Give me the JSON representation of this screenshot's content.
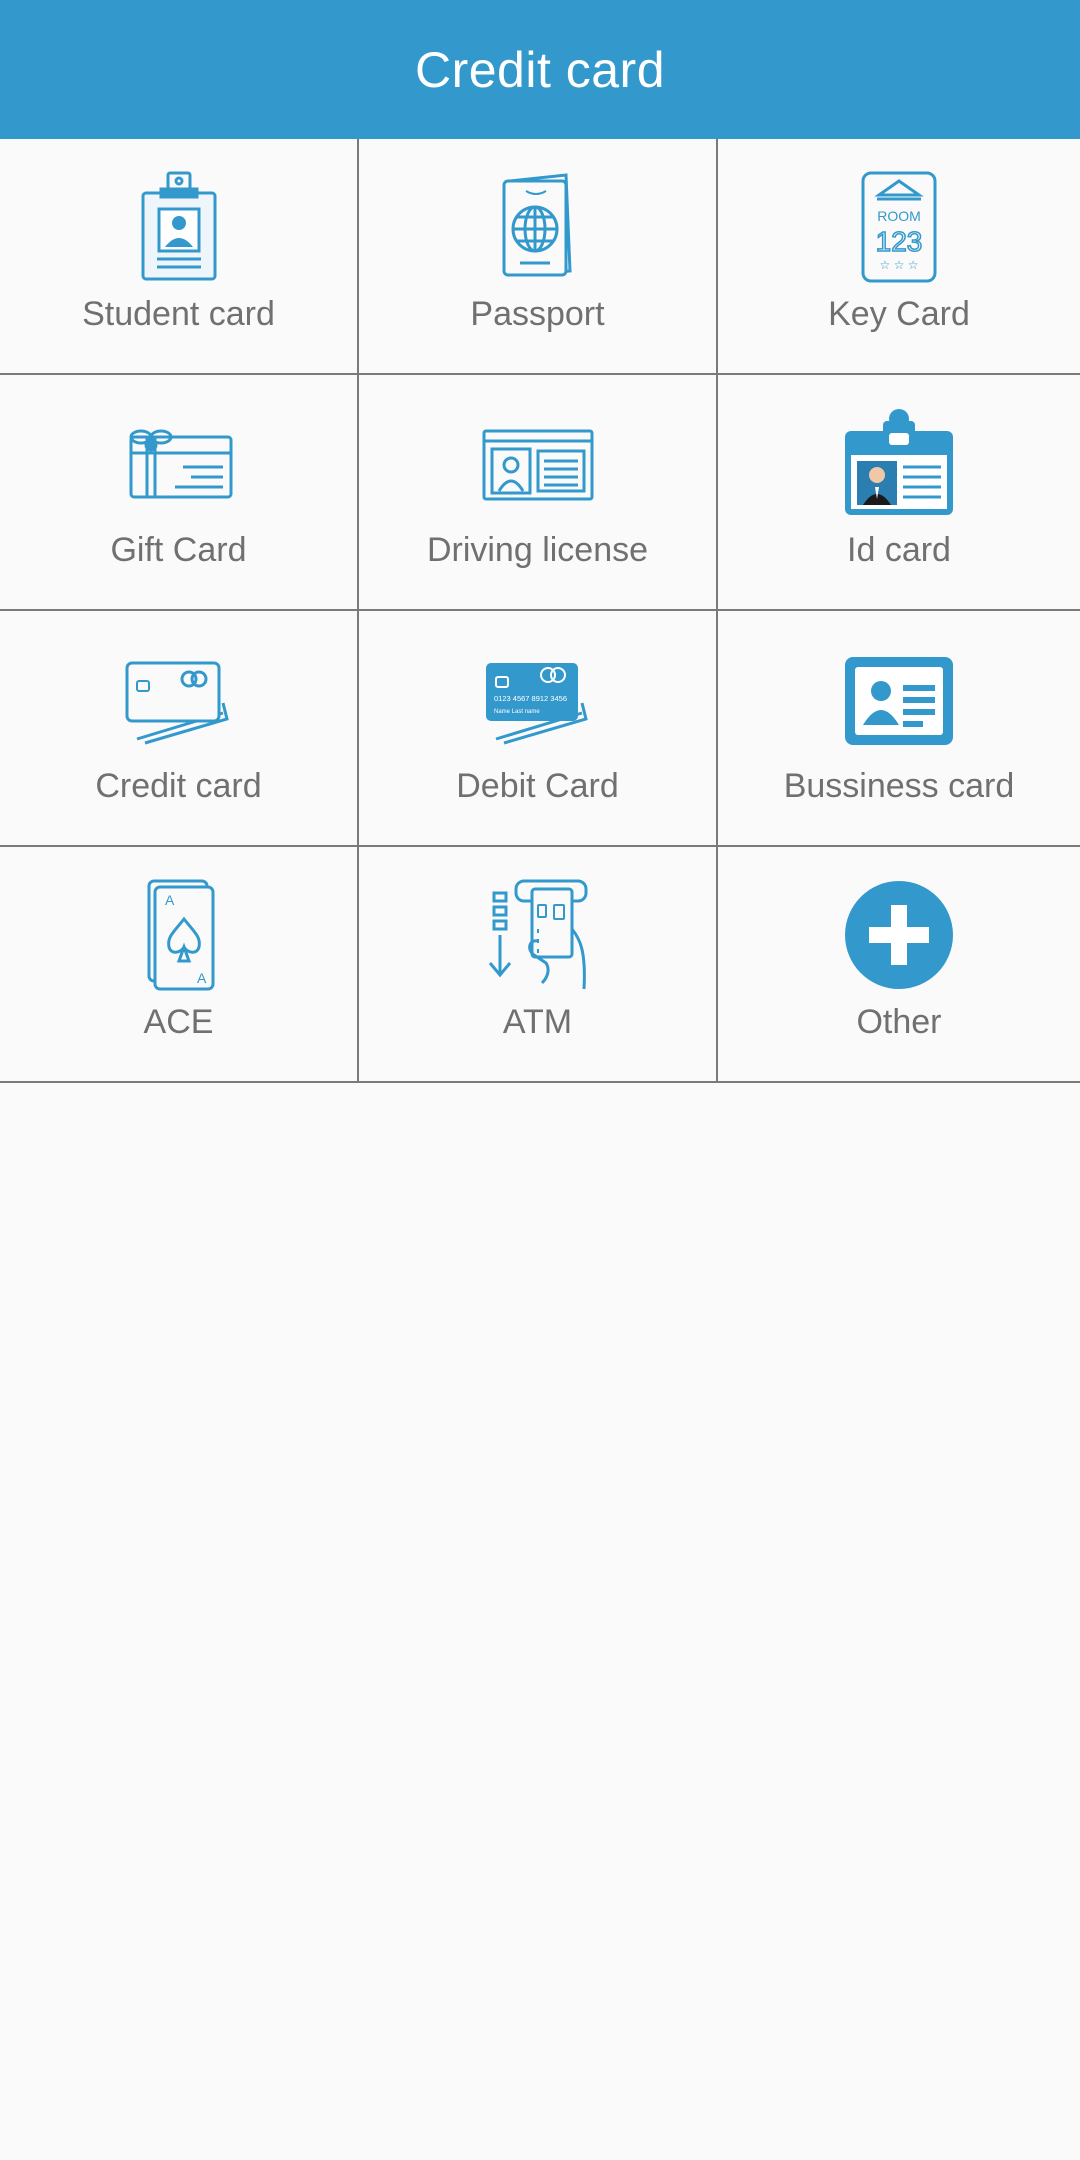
{
  "appbar": {
    "title": "Credit card",
    "color": "#3399cc"
  },
  "accent_color": "#3399cc",
  "items": [
    {
      "label": "Student card",
      "icon": "student-card-icon"
    },
    {
      "label": "Passport",
      "icon": "passport-icon"
    },
    {
      "label": "Key Card",
      "icon": "key-card-icon"
    },
    {
      "label": "Gift Card",
      "icon": "gift-card-icon"
    },
    {
      "label": "Driving license",
      "icon": "driving-license-icon"
    },
    {
      "label": "Id card",
      "icon": "id-card-icon"
    },
    {
      "label": "Credit card",
      "icon": "credit-card-icon"
    },
    {
      "label": "Debit Card",
      "icon": "debit-card-icon"
    },
    {
      "label": "Bussiness card",
      "icon": "business-card-icon"
    },
    {
      "label": "ACE",
      "icon": "ace-card-icon"
    },
    {
      "label": "ATM",
      "icon": "atm-icon"
    },
    {
      "label": "Other",
      "icon": "plus-circle-icon"
    }
  ],
  "icon_text": {
    "room": "ROOM",
    "room_number": "123",
    "card_number": "0123 4567 8912 3456",
    "card_name": "Name  Last name",
    "ace_letter": "A"
  }
}
